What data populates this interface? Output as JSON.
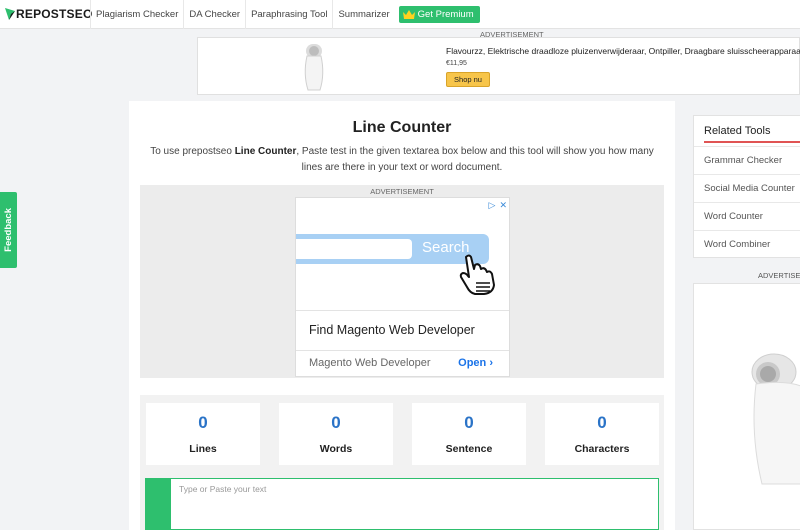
{
  "nav": {
    "logo_text": "REPOSTSEO",
    "links": [
      "Plagiarism Checker",
      "DA Checker",
      "Paraphrasing Tool",
      "Summarizer"
    ],
    "premium_label": "Get Premium",
    "accent_color": "#2ebf6e"
  },
  "top_ad": {
    "label": "ADVERTISEMENT",
    "title": "Flavourzz, Elektrische draadloze pluizenverwijderaar, Ontpiller, Draagbare sluisscheerapparaa.",
    "price": "€11,95",
    "button": "Shop nu"
  },
  "feedback": {
    "label": "Feedback"
  },
  "main": {
    "title": "Line Counter",
    "desc_before": "To use prepostseo ",
    "desc_bold": "Line Counter",
    "desc_after": ", Paste test in the given textarea box below and this tool will show you how many lines are there in your text or word document."
  },
  "mid_ad": {
    "label": "ADVERTISEMENT",
    "search_label": "Search",
    "headline": "Find Magento Web Developer",
    "sub": "Magento Web Developer",
    "open": "Open"
  },
  "stats": [
    {
      "value": "0",
      "label": "Lines"
    },
    {
      "value": "0",
      "label": "Words"
    },
    {
      "value": "0",
      "label": "Sentence"
    },
    {
      "value": "0",
      "label": "Characters"
    }
  ],
  "editor": {
    "placeholder": "Type or Paste your text"
  },
  "related": {
    "title": "Related Tools",
    "items": [
      "Grammar Checker",
      "Social Media Counter",
      "Word Counter",
      "Word Combiner"
    ]
  },
  "side_ad": {
    "label": "ADVERTISEMENT"
  }
}
